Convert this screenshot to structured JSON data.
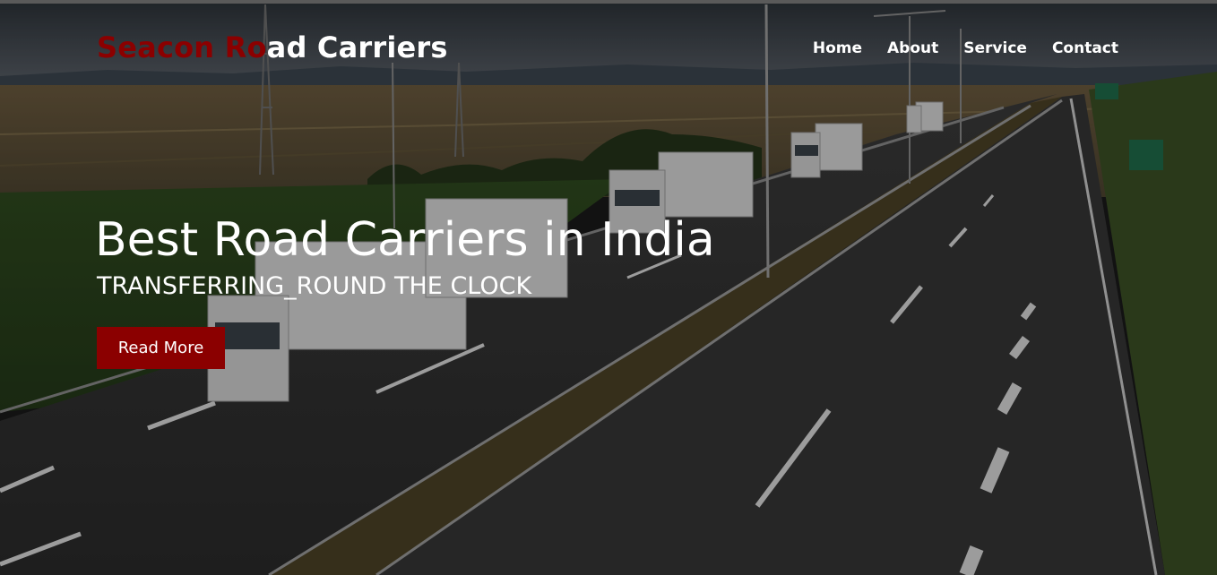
{
  "brand": {
    "accent": "Seacon Ro",
    "rest": "ad Carriers"
  },
  "nav": {
    "items": [
      "Home",
      "About",
      "Service",
      "Contact"
    ]
  },
  "hero": {
    "headline": "Best Road Carriers in India",
    "subline": "TRANSFERRING_ROUND THE CLOCK",
    "cta_label": "Read More"
  },
  "colors": {
    "accent": "#8b0000",
    "text": "#ffffff"
  }
}
